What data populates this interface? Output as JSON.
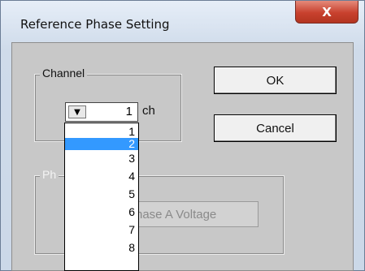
{
  "window": {
    "title": "Reference Phase Setting",
    "close_glyph": "X"
  },
  "channel_group": {
    "label": "Channel"
  },
  "channel_combo": {
    "value": "1",
    "unit": "ch",
    "arrow_glyph": "▼"
  },
  "dropdown": {
    "items": [
      "1",
      "2",
      "3",
      "4",
      "5",
      "6",
      "7",
      "8"
    ],
    "selected_index": 1
  },
  "buttons": {
    "ok": "OK",
    "cancel": "Cancel"
  },
  "phase_group": {
    "label_partial": "Ph"
  },
  "phase_button": {
    "label_partial": "hase A Voltage"
  },
  "colors": {
    "selection": "#3399ff",
    "close": "#c8412e"
  }
}
